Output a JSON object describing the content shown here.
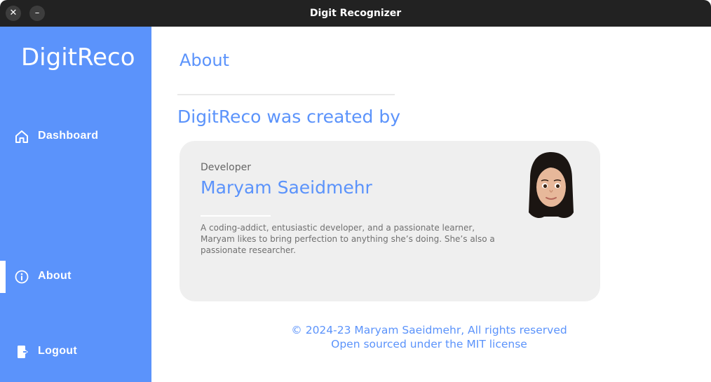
{
  "window": {
    "title": "Digit Recognizer",
    "close_glyph": "✕",
    "minimize_glyph": "–"
  },
  "sidebar": {
    "brand": "DigitReco",
    "items": [
      {
        "label": "Dashboard",
        "icon": "home-icon",
        "active": false
      },
      {
        "label": "About",
        "icon": "info-icon",
        "active": true
      },
      {
        "label": "Logout",
        "icon": "logout-icon",
        "active": false
      }
    ]
  },
  "main": {
    "title": "About",
    "section_title": "DigitReco was created by",
    "card": {
      "role": "Developer",
      "name": "Maryam Saeidmehr",
      "bio": "A coding-addict, entusiastic developer, and a passionate learner, Maryam likes to bring perfection to anything she’s doing. She’s also a passionate researcher.",
      "avatar": "memoji-avatar"
    },
    "footer": {
      "copyright": "© 2024-23 Maryam Saeidmehr, All rights reserved",
      "license": "Open sourced under the MIT license"
    }
  },
  "colors": {
    "accent": "#5b93fb",
    "card_bg": "#efefef",
    "titlebar": "#222222"
  }
}
